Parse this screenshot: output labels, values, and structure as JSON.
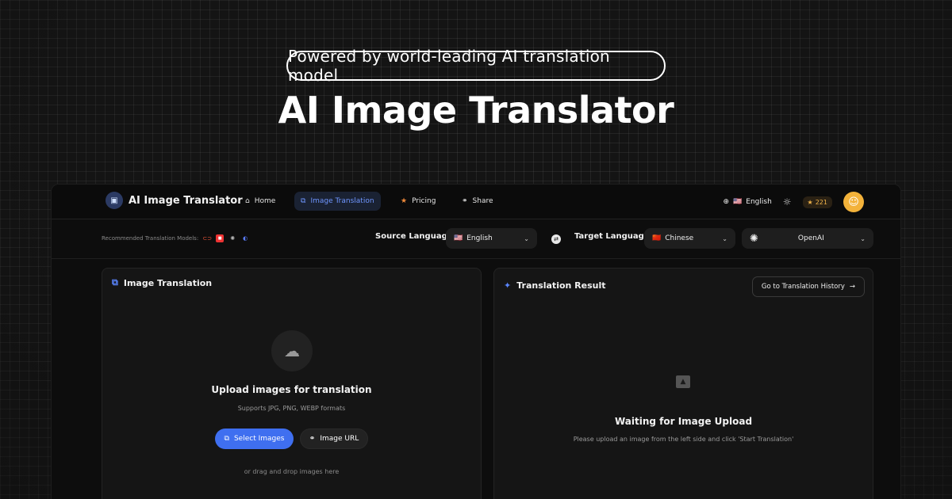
{
  "hero": {
    "pill": "Powered by world-leading AI translation model",
    "title": "AI Image Translator"
  },
  "navbar": {
    "brand": "AI Image Translator",
    "items": [
      {
        "label": "Home",
        "icon": "home-icon"
      },
      {
        "label": "Image Translation",
        "icon": "edit-image-icon",
        "active": true
      },
      {
        "label": "Pricing",
        "icon": "star-icon"
      },
      {
        "label": "Share",
        "icon": "link-icon"
      }
    ],
    "language": "English",
    "language_flag": "🇺🇸",
    "credits": "221",
    "accent": "#6f96ff"
  },
  "toolbar": {
    "recommended_label": "Recommended Translation Models:",
    "source_label": "Source Language:",
    "source_value": "English",
    "source_flag": "🇺🇸",
    "target_label": "Target Language:",
    "target_value": "Chinese",
    "target_flag": "🇨🇳",
    "model_value": "OpenAI"
  },
  "left_panel": {
    "title": "Image Translation",
    "upload_title": "Upload images for translation",
    "upload_sub": "Supports JPG, PNG, WEBP formats",
    "select_button": "Select Images",
    "url_button": "Image URL",
    "drag_text": "or drag and drop images here"
  },
  "right_panel": {
    "title": "Translation Result",
    "history_button": "Go to Translation History",
    "wait_title": "Waiting for Image Upload",
    "wait_sub": "Please upload an image from the left side and click 'Start Translation'"
  },
  "colors": {
    "primary_button": "#3f6ff0",
    "credits": "#f0b34a"
  }
}
